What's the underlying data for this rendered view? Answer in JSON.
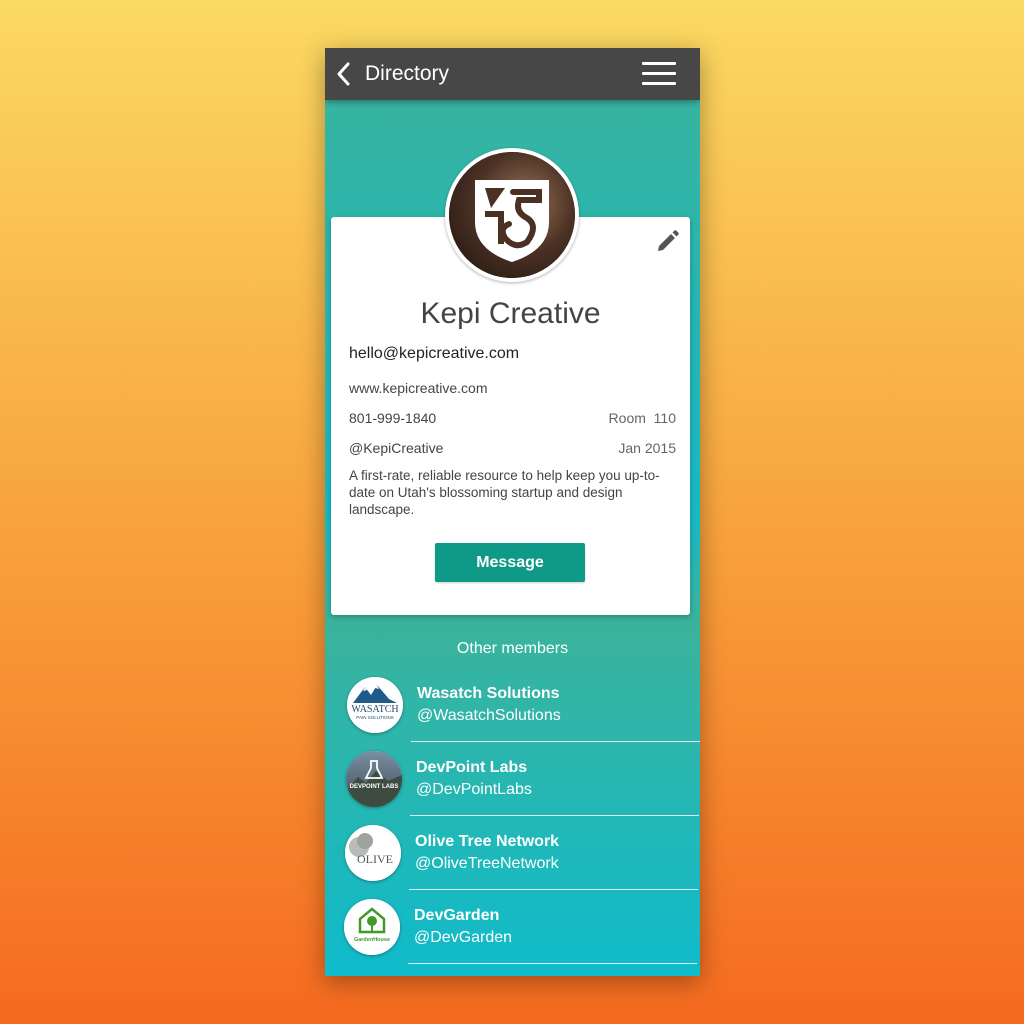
{
  "nav": {
    "back_icon": "chevron-left-icon",
    "title": "Directory",
    "menu_icon": "hamburger-menu-icon"
  },
  "profile": {
    "name": "Kepi Creative",
    "email": "hello@kepicreative.com",
    "website": "www.kepicreative.com",
    "phone": "801-999-1840",
    "room": "Room  110",
    "handle": "@KepiCreative",
    "joined": "Jan 2015",
    "description": "A first-rate, reliable resource to help keep you up-to-date on Utah's blossoming startup and design landscape.",
    "message_label": "Message",
    "edit_icon": "pencil-icon"
  },
  "other_members": {
    "title": "Other members",
    "items": [
      {
        "name": "Wasatch Solutions",
        "handle": "@WasatchSolutions"
      },
      {
        "name": "DevPoint Labs",
        "handle": "@DevPointLabs"
      },
      {
        "name": "Olive Tree Network",
        "handle": "@OliveTreeNetwork"
      },
      {
        "name": "DevGarden",
        "handle": "@DevGarden"
      }
    ],
    "logo_text": {
      "wasatch": "WASATCH",
      "wasatch_sub": "PAIN SOLUTIONS",
      "devpoint": "DEVPOINT LABS",
      "olive": "OLIVE",
      "garden": "GardenHouse"
    }
  },
  "colors": {
    "nav_bg": "#474747",
    "accent": "#0f9a88",
    "card_bg": "#ffffff"
  }
}
